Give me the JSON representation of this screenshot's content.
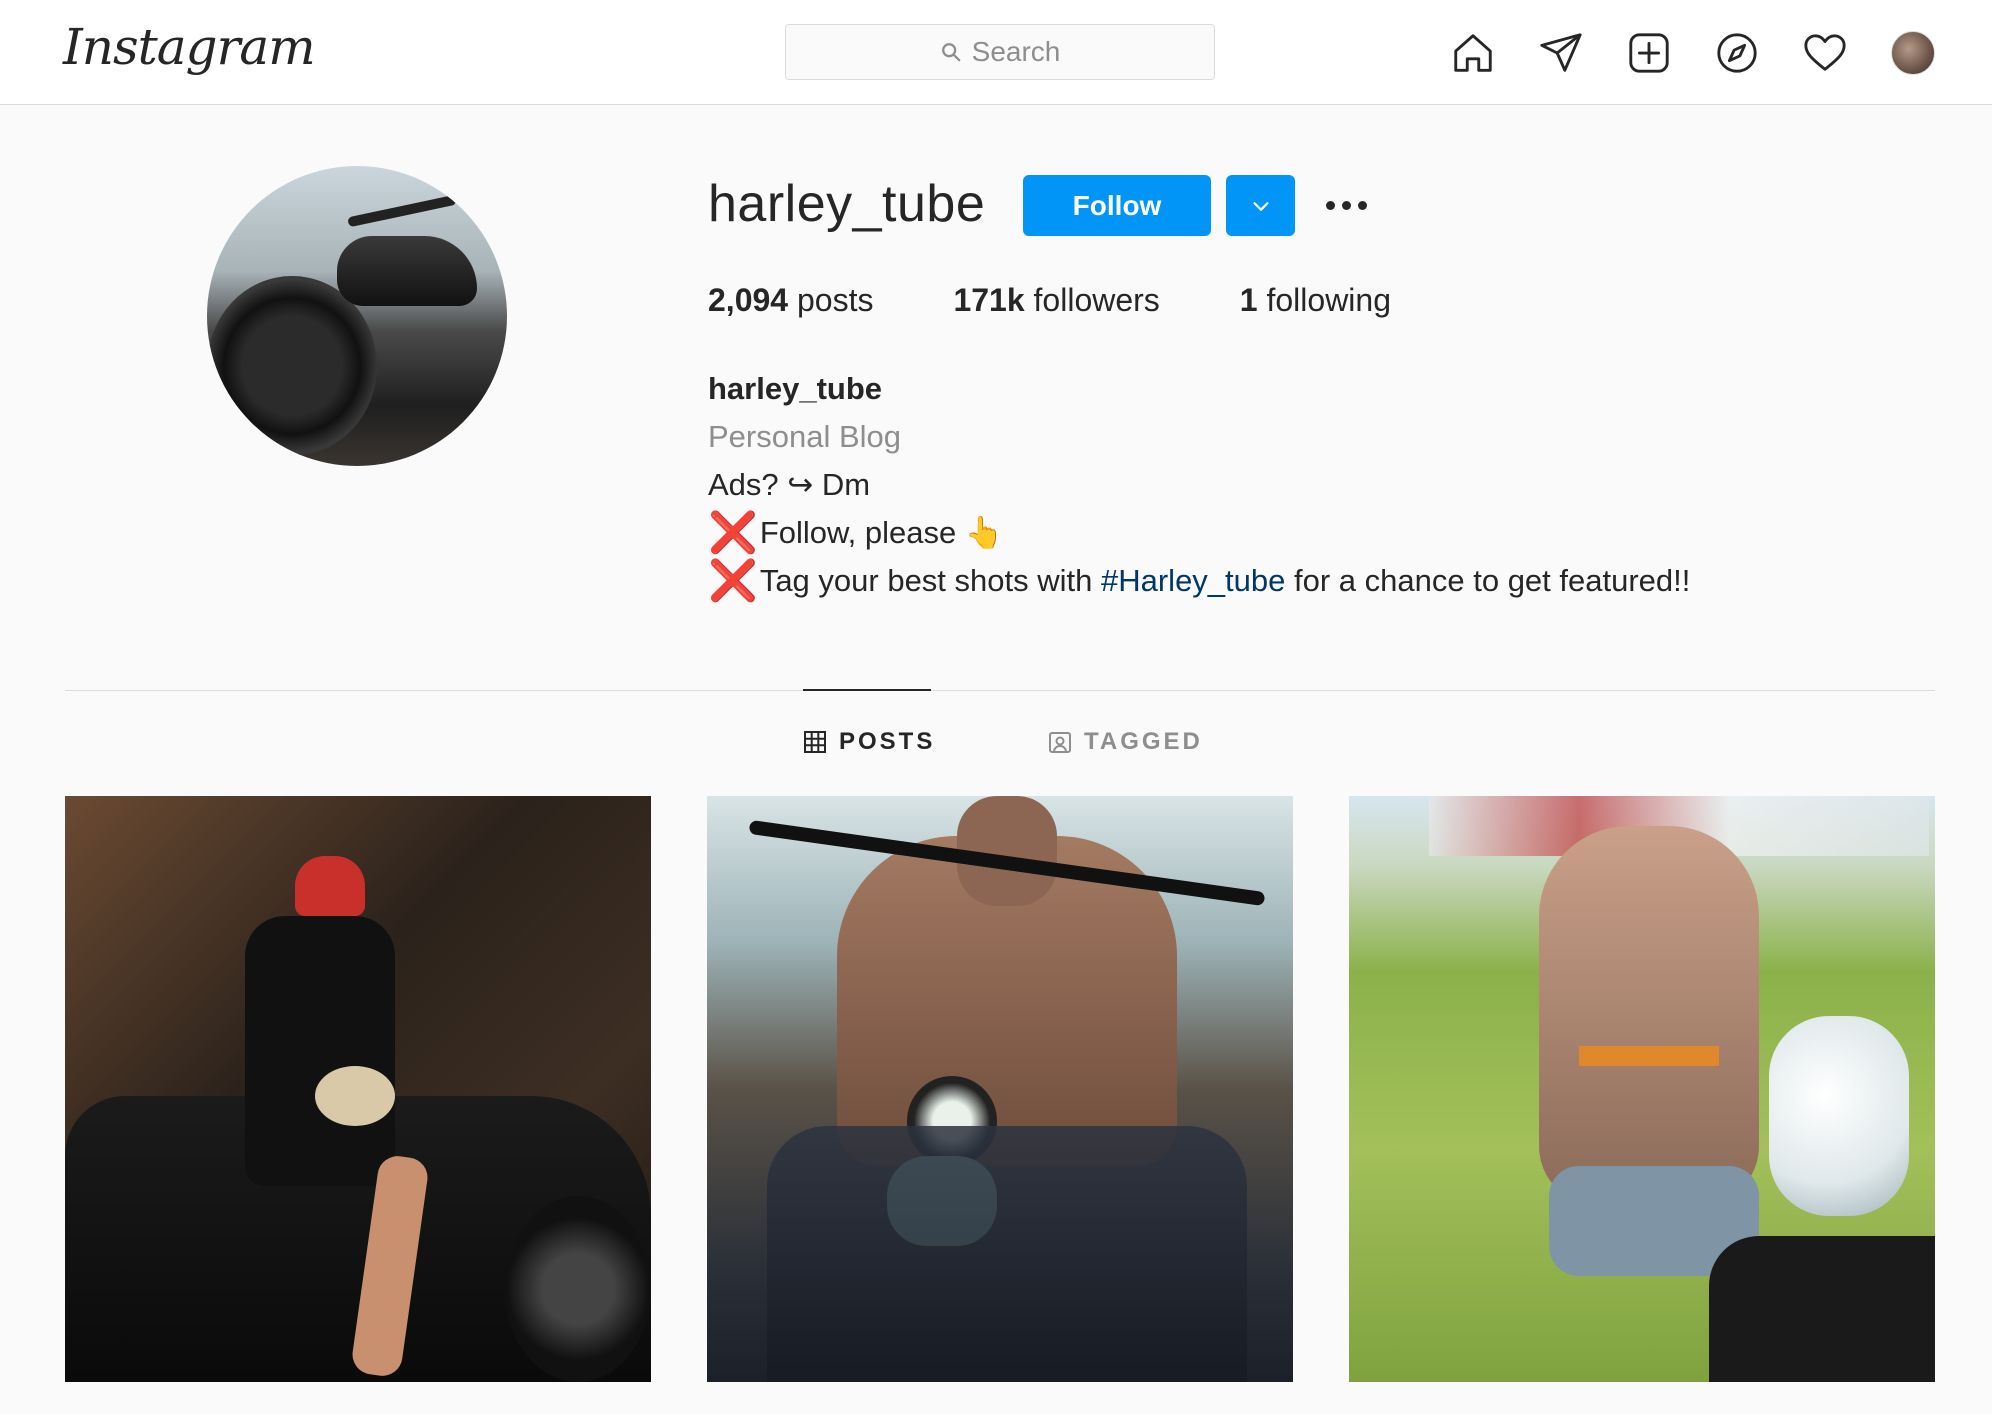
{
  "header": {
    "logo_text": "Instagram",
    "search_placeholder": "Search",
    "nav_icons": [
      "home-icon",
      "direct-icon",
      "new-post-icon",
      "explore-icon",
      "activity-icon",
      "avatar"
    ]
  },
  "profile": {
    "username": "harley_tube",
    "follow_label": "Follow",
    "stats": {
      "posts_count": "2,094",
      "posts_label": "posts",
      "followers_count": "171k",
      "followers_label": "followers",
      "following_count": "1",
      "following_label": "following"
    },
    "bio": {
      "name": "harley_tube",
      "category": "Personal Blog",
      "line1": "Ads? ↪ Dm",
      "line2_text": "Follow, please",
      "line2_emoji": "👆",
      "line3_before": "Tag your best shots with ",
      "line3_hashtag": "#Harley_tube",
      "line3_after": " for a chance to get featured!!",
      "cross_mark": "❌"
    }
  },
  "tabs": {
    "posts_label": "POSTS",
    "tagged_label": "TAGGED",
    "active": "POSTS"
  },
  "colors": {
    "accent": "#0095f6",
    "hashtag": "#00376b",
    "muted": "#8e8e8e",
    "text": "#262626",
    "cross": "#e0201b"
  }
}
